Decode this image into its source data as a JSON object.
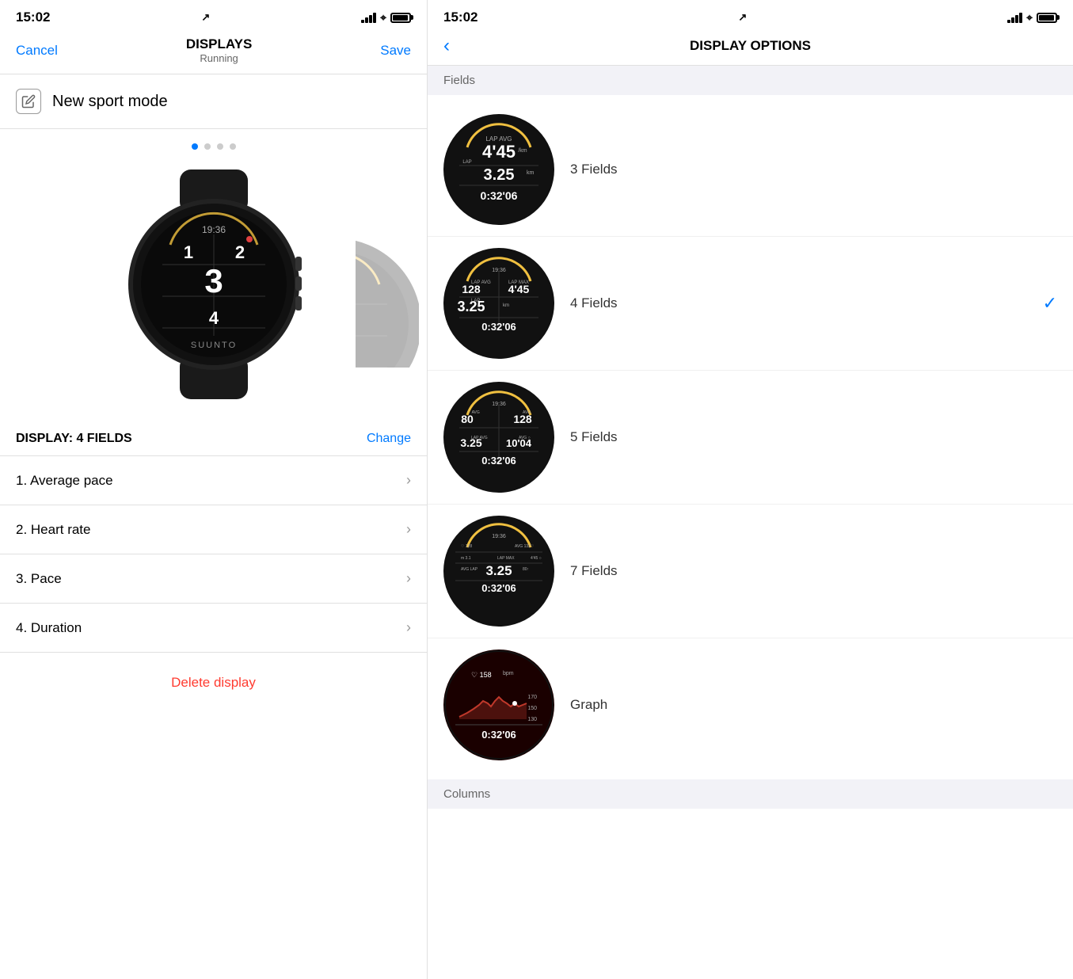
{
  "left": {
    "statusBar": {
      "time": "15:02",
      "locationIcon": "✈"
    },
    "nav": {
      "cancel": "Cancel",
      "title": "DISPLAYS",
      "subtitle": "Running",
      "save": "Save"
    },
    "sportMode": {
      "label": "New sport mode"
    },
    "dots": [
      true,
      false,
      false,
      false
    ],
    "displaySection": {
      "title": "DISPLAY: 4 FIELDS",
      "changeLabel": "Change"
    },
    "fields": [
      {
        "id": 1,
        "label": "1. Average pace"
      },
      {
        "id": 2,
        "label": "2. Heart rate"
      },
      {
        "id": 3,
        "label": "3. Pace"
      },
      {
        "id": 4,
        "label": "4. Duration"
      }
    ],
    "deleteLabel": "Delete display"
  },
  "right": {
    "statusBar": {
      "time": "15:02"
    },
    "nav": {
      "backIcon": "‹",
      "title": "DISPLAY OPTIONS"
    },
    "fieldsSection": "Fields",
    "options": [
      {
        "id": "3fields",
        "label": "3 Fields",
        "selected": false
      },
      {
        "id": "4fields",
        "label": "4 Fields",
        "selected": true
      },
      {
        "id": "5fields",
        "label": "5 Fields",
        "selected": false
      },
      {
        "id": "7fields",
        "label": "7 Fields",
        "selected": false
      },
      {
        "id": "graph",
        "label": "Graph",
        "selected": false
      }
    ],
    "columnsSection": "Columns"
  }
}
